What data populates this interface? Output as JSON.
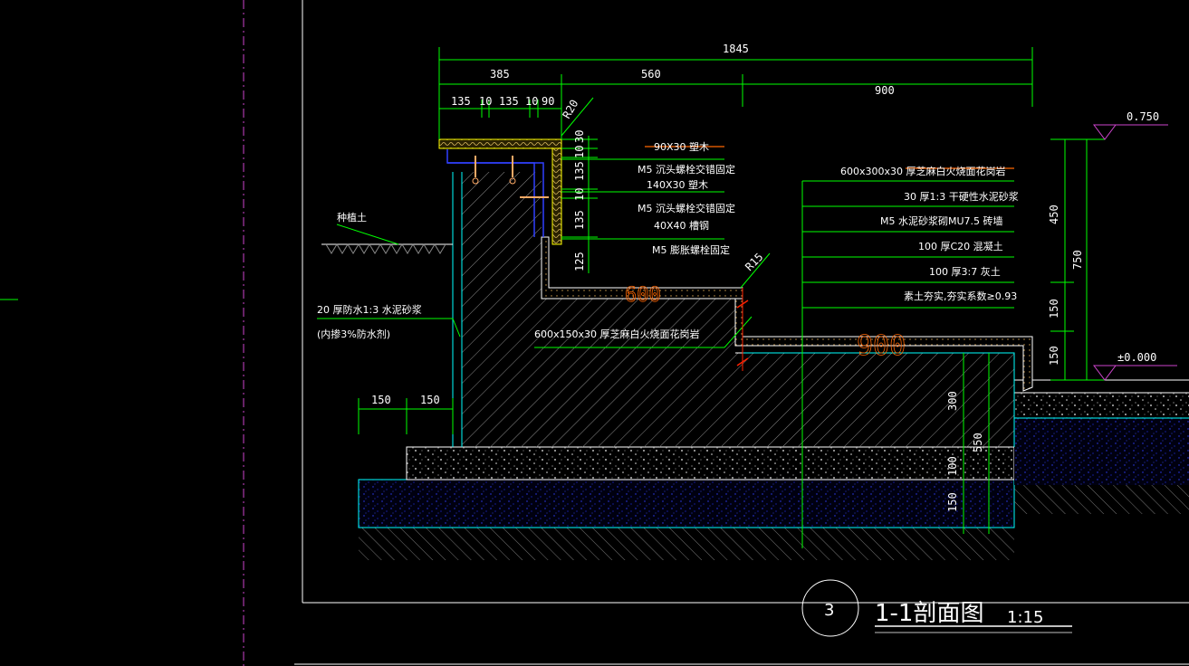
{
  "colors": {
    "background": "#000000",
    "dimension": "#00ff00",
    "outline": "#00ffff",
    "text": "#ffffff",
    "hatch": "#a0a0a0",
    "leader": "#ff6600",
    "wood": "#e0c070",
    "bolt": "#ffaa66",
    "level": "#cc44cc",
    "aggregate": "#3040ff"
  },
  "title": {
    "number": "3",
    "name": "1-1剖面图",
    "scale": "1:15"
  },
  "dimensions_top": {
    "overall": "1845",
    "d385": "385",
    "d560": "560",
    "d900": "900",
    "a1": "135",
    "a2": "10",
    "a3": "135",
    "a4": "10",
    "a5": "90",
    "r20": "R20"
  },
  "dimensions_left_col": {
    "d30": "30",
    "d10a": "10",
    "d135a": "135",
    "d10b": "10",
    "d135b": "135",
    "d125": "125"
  },
  "dimensions_right": {
    "d450": "450",
    "d750": "750",
    "d150a": "150",
    "d150b": "150"
  },
  "dimensions_base": {
    "d300": "300",
    "d550": "550",
    "d100": "100",
    "d150": "150"
  },
  "dimensions_bottom_left": {
    "a": "150",
    "b": "150"
  },
  "levels": {
    "top": "0.750",
    "ground": "±0.000"
  },
  "radius_r15": "R15",
  "notes_left": [
    "90X30   塑木",
    "M5  沉头螺栓交错固定",
    "140X30   塑木",
    "M5  沉头螺栓交错固定",
    "40X40   槽钢",
    "M5  膨胀螺栓固定"
  ],
  "notes_right": [
    "600x300x30      厚芝麻白火烧面花岗岩",
    "30  厚1:3  干硬性水泥砂浆",
    "M5  水泥砂浆砌MU7.5   砖墙",
    "100  厚C20  混凝土",
    "100  厚3:7  灰土",
    "素土夯实,夯实系数≥0.93"
  ],
  "note_seat": "600x150x30      厚芝麻白火烧面花岗岩",
  "note_soil": "种植土",
  "note_waterproof_1": "20  厚防水1:3   水泥砂浆",
  "note_waterproof_2": "(内掺3%防水剂)",
  "overlay_600": "600",
  "overlay_900": "900"
}
